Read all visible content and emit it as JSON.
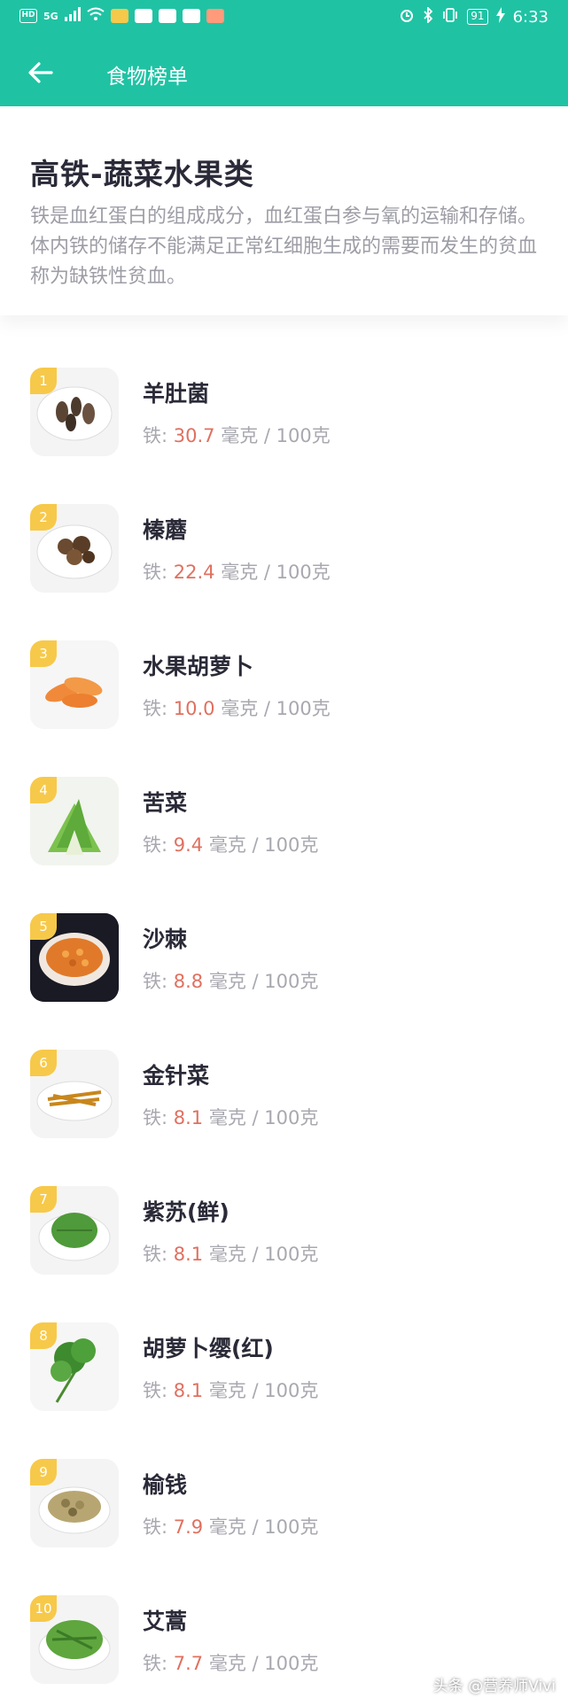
{
  "status_bar": {
    "left_text": "HD",
    "signal": "5G",
    "battery": "91",
    "time": "6:33"
  },
  "header": {
    "title": "食物榜单"
  },
  "intro": {
    "title": "高铁-蔬菜水果类",
    "description": "铁是血红蛋白的组成成分，血红蛋白参与氧的运输和存储。体内铁的储存不能满足正常红细胞生成的需要而发生的贫血称为缺铁性贫血。"
  },
  "labels": {
    "iron_prefix": "铁: ",
    "iron_unit": " 毫克 / 100克"
  },
  "items": [
    {
      "rank": "1",
      "name": "羊肚菌",
      "iron": "30.7"
    },
    {
      "rank": "2",
      "name": "榛蘑",
      "iron": "22.4"
    },
    {
      "rank": "3",
      "name": "水果胡萝卜",
      "iron": "10.0"
    },
    {
      "rank": "4",
      "name": "苦菜",
      "iron": "9.4"
    },
    {
      "rank": "5",
      "name": "沙棘",
      "iron": "8.8"
    },
    {
      "rank": "6",
      "name": "金针菜",
      "iron": "8.1"
    },
    {
      "rank": "7",
      "name": "紫苏(鲜)",
      "iron": "8.1"
    },
    {
      "rank": "8",
      "name": "胡萝卜缨(红)",
      "iron": "8.1"
    },
    {
      "rank": "9",
      "name": "榆钱",
      "iron": "7.9"
    },
    {
      "rank": "10",
      "name": "艾蒿",
      "iron": "7.7"
    }
  ],
  "watermark": "头条 @营养师Vivi",
  "colors": {
    "header_bg": "#1fc3a4",
    "rank_badge": "#f7c94a",
    "iron_value": "#e0705f"
  }
}
